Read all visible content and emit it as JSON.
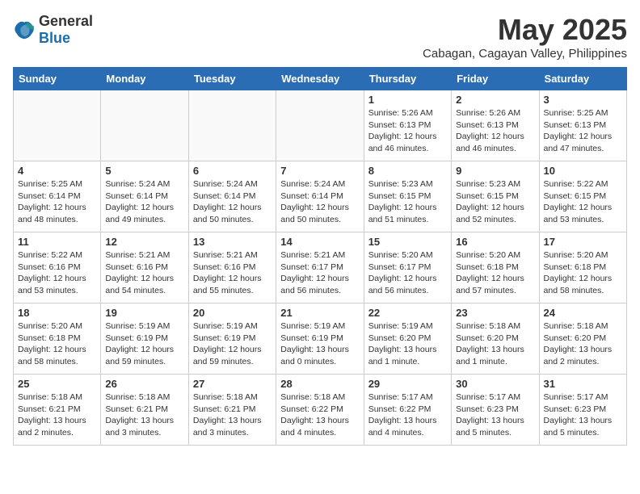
{
  "logo": {
    "general": "General",
    "blue": "Blue"
  },
  "title": "May 2025",
  "subtitle": "Cabagan, Cagayan Valley, Philippines",
  "weekdays": [
    "Sunday",
    "Monday",
    "Tuesday",
    "Wednesday",
    "Thursday",
    "Friday",
    "Saturday"
  ],
  "weeks": [
    [
      {
        "day": "",
        "info": ""
      },
      {
        "day": "",
        "info": ""
      },
      {
        "day": "",
        "info": ""
      },
      {
        "day": "",
        "info": ""
      },
      {
        "day": "1",
        "info": "Sunrise: 5:26 AM\nSunset: 6:13 PM\nDaylight: 12 hours\nand 46 minutes."
      },
      {
        "day": "2",
        "info": "Sunrise: 5:26 AM\nSunset: 6:13 PM\nDaylight: 12 hours\nand 46 minutes."
      },
      {
        "day": "3",
        "info": "Sunrise: 5:25 AM\nSunset: 6:13 PM\nDaylight: 12 hours\nand 47 minutes."
      }
    ],
    [
      {
        "day": "4",
        "info": "Sunrise: 5:25 AM\nSunset: 6:14 PM\nDaylight: 12 hours\nand 48 minutes."
      },
      {
        "day": "5",
        "info": "Sunrise: 5:24 AM\nSunset: 6:14 PM\nDaylight: 12 hours\nand 49 minutes."
      },
      {
        "day": "6",
        "info": "Sunrise: 5:24 AM\nSunset: 6:14 PM\nDaylight: 12 hours\nand 50 minutes."
      },
      {
        "day": "7",
        "info": "Sunrise: 5:24 AM\nSunset: 6:14 PM\nDaylight: 12 hours\nand 50 minutes."
      },
      {
        "day": "8",
        "info": "Sunrise: 5:23 AM\nSunset: 6:15 PM\nDaylight: 12 hours\nand 51 minutes."
      },
      {
        "day": "9",
        "info": "Sunrise: 5:23 AM\nSunset: 6:15 PM\nDaylight: 12 hours\nand 52 minutes."
      },
      {
        "day": "10",
        "info": "Sunrise: 5:22 AM\nSunset: 6:15 PM\nDaylight: 12 hours\nand 53 minutes."
      }
    ],
    [
      {
        "day": "11",
        "info": "Sunrise: 5:22 AM\nSunset: 6:16 PM\nDaylight: 12 hours\nand 53 minutes."
      },
      {
        "day": "12",
        "info": "Sunrise: 5:21 AM\nSunset: 6:16 PM\nDaylight: 12 hours\nand 54 minutes."
      },
      {
        "day": "13",
        "info": "Sunrise: 5:21 AM\nSunset: 6:16 PM\nDaylight: 12 hours\nand 55 minutes."
      },
      {
        "day": "14",
        "info": "Sunrise: 5:21 AM\nSunset: 6:17 PM\nDaylight: 12 hours\nand 56 minutes."
      },
      {
        "day": "15",
        "info": "Sunrise: 5:20 AM\nSunset: 6:17 PM\nDaylight: 12 hours\nand 56 minutes."
      },
      {
        "day": "16",
        "info": "Sunrise: 5:20 AM\nSunset: 6:18 PM\nDaylight: 12 hours\nand 57 minutes."
      },
      {
        "day": "17",
        "info": "Sunrise: 5:20 AM\nSunset: 6:18 PM\nDaylight: 12 hours\nand 58 minutes."
      }
    ],
    [
      {
        "day": "18",
        "info": "Sunrise: 5:20 AM\nSunset: 6:18 PM\nDaylight: 12 hours\nand 58 minutes."
      },
      {
        "day": "19",
        "info": "Sunrise: 5:19 AM\nSunset: 6:19 PM\nDaylight: 12 hours\nand 59 minutes."
      },
      {
        "day": "20",
        "info": "Sunrise: 5:19 AM\nSunset: 6:19 PM\nDaylight: 12 hours\nand 59 minutes."
      },
      {
        "day": "21",
        "info": "Sunrise: 5:19 AM\nSunset: 6:19 PM\nDaylight: 13 hours\nand 0 minutes."
      },
      {
        "day": "22",
        "info": "Sunrise: 5:19 AM\nSunset: 6:20 PM\nDaylight: 13 hours\nand 1 minute."
      },
      {
        "day": "23",
        "info": "Sunrise: 5:18 AM\nSunset: 6:20 PM\nDaylight: 13 hours\nand 1 minute."
      },
      {
        "day": "24",
        "info": "Sunrise: 5:18 AM\nSunset: 6:20 PM\nDaylight: 13 hours\nand 2 minutes."
      }
    ],
    [
      {
        "day": "25",
        "info": "Sunrise: 5:18 AM\nSunset: 6:21 PM\nDaylight: 13 hours\nand 2 minutes."
      },
      {
        "day": "26",
        "info": "Sunrise: 5:18 AM\nSunset: 6:21 PM\nDaylight: 13 hours\nand 3 minutes."
      },
      {
        "day": "27",
        "info": "Sunrise: 5:18 AM\nSunset: 6:21 PM\nDaylight: 13 hours\nand 3 minutes."
      },
      {
        "day": "28",
        "info": "Sunrise: 5:18 AM\nSunset: 6:22 PM\nDaylight: 13 hours\nand 4 minutes."
      },
      {
        "day": "29",
        "info": "Sunrise: 5:17 AM\nSunset: 6:22 PM\nDaylight: 13 hours\nand 4 minutes."
      },
      {
        "day": "30",
        "info": "Sunrise: 5:17 AM\nSunset: 6:23 PM\nDaylight: 13 hours\nand 5 minutes."
      },
      {
        "day": "31",
        "info": "Sunrise: 5:17 AM\nSunset: 6:23 PM\nDaylight: 13 hours\nand 5 minutes."
      }
    ]
  ]
}
